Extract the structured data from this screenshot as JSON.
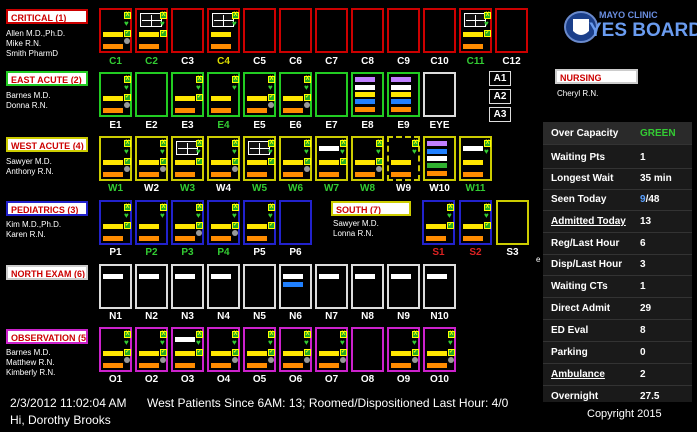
{
  "logo": {
    "top": "MAYO CLINIC",
    "main": "YES BOARD",
    "reg": "®"
  },
  "sections": {
    "critical": {
      "title": "CRITICAL",
      "count": "(1)",
      "staff": [
        "Allen M.D.,Ph.D.",
        "Mike R.N.",
        "Smith PharmD"
      ]
    },
    "east": {
      "title": "EAST ACUTE",
      "count": "(2)",
      "staff": [
        "Barnes M.D.",
        "Donna R.N."
      ]
    },
    "west": {
      "title": "WEST ACUTE",
      "count": "(4)",
      "staff": [
        "Sawyer M.D.",
        "Anthony R.N."
      ]
    },
    "peds": {
      "title": "PEDIATRICS",
      "count": "(3)",
      "staff": [
        "Kim M.D.,Ph.D.",
        "Karen R.N."
      ]
    },
    "south": {
      "title": "SOUTH",
      "count": "(7)",
      "staff": [
        "Sawyer M.D.",
        "Lonna R.N."
      ]
    },
    "north": {
      "title": "NORTH EXAM",
      "count": "(6)"
    },
    "obs": {
      "title": "OBSERVATION",
      "count": "(5)",
      "staff": [
        "Barnes M.D.",
        "Matthew R.N.",
        "Kimberly R.N."
      ]
    },
    "nursing": {
      "title": "NURSING",
      "staff": [
        "Cheryl R.N."
      ]
    }
  },
  "rooms": {
    "critical": [
      "C1",
      "C2",
      "C3",
      "C4",
      "C5",
      "C6",
      "C7",
      "C8",
      "C9",
      "C10",
      "C11",
      "C12"
    ],
    "east": [
      "E1",
      "E2",
      "E3",
      "E4",
      "E5",
      "E6",
      "E7",
      "E8",
      "E9",
      "EYE"
    ],
    "a_rooms": [
      "A1",
      "A2",
      "A3"
    ],
    "west": [
      "W1",
      "W2",
      "W3",
      "W4",
      "W5",
      "W6",
      "W7",
      "W8",
      "W9",
      "W10",
      "W11"
    ],
    "peds": [
      "P1",
      "P2",
      "P3",
      "P4",
      "P5",
      "P6"
    ],
    "south": [
      "S1",
      "S2",
      "S3"
    ],
    "north": [
      "N1",
      "N2",
      "N3",
      "N4",
      "N5",
      "N6",
      "N7",
      "N8",
      "N9",
      "N10"
    ],
    "obs": [
      "O1",
      "O2",
      "O3",
      "O4",
      "O5",
      "O6",
      "O7",
      "O8",
      "O9",
      "O10"
    ]
  },
  "colors": {
    "critical": "#cc0000",
    "east": "#22cc22",
    "west": "#cccc00",
    "peds": "#2222cc",
    "north": "#dddddd",
    "obs": "#cc22cc",
    "south": "#cccc00",
    "label_green": "#33cc33",
    "label_yellow": "#dddd00",
    "label_red": "#dd2222",
    "label_white": "#ffffff"
  },
  "stats": [
    {
      "label": "Over Capacity",
      "value": "GREEN"
    },
    {
      "label": "Waiting Pts",
      "value": "1"
    },
    {
      "label": "Longest Wait",
      "value": "35 min"
    },
    {
      "label": "Seen Today",
      "value_a": "9",
      "sep": "/",
      "value_b": "48"
    },
    {
      "label": "Admitted Today",
      "value": "13"
    },
    {
      "label": "Reg/Last Hour",
      "value": "6"
    },
    {
      "label": "Disp/Last Hour",
      "value": "3"
    },
    {
      "label": "Waiting CTs",
      "value": "1"
    },
    {
      "label": "Direct Admit",
      "value": "29"
    },
    {
      "label": "ED Eval",
      "value": "8"
    },
    {
      "label": "Parking",
      "value": "0"
    },
    {
      "label": "Ambulance",
      "value": "2"
    },
    {
      "label": "Overnight",
      "value": "27.5"
    }
  ],
  "footer": {
    "datetime": "2/3/2012 11:02:04 AM",
    "greeting": "Hi, Dorothy Brooks",
    "west_summary": "West Patients Since 6AM: 13; Roomed/Dispositioned Last Hour: 4/0",
    "copyright": "Copyright 2015"
  },
  "misc": {
    "s3_marker": "e"
  }
}
